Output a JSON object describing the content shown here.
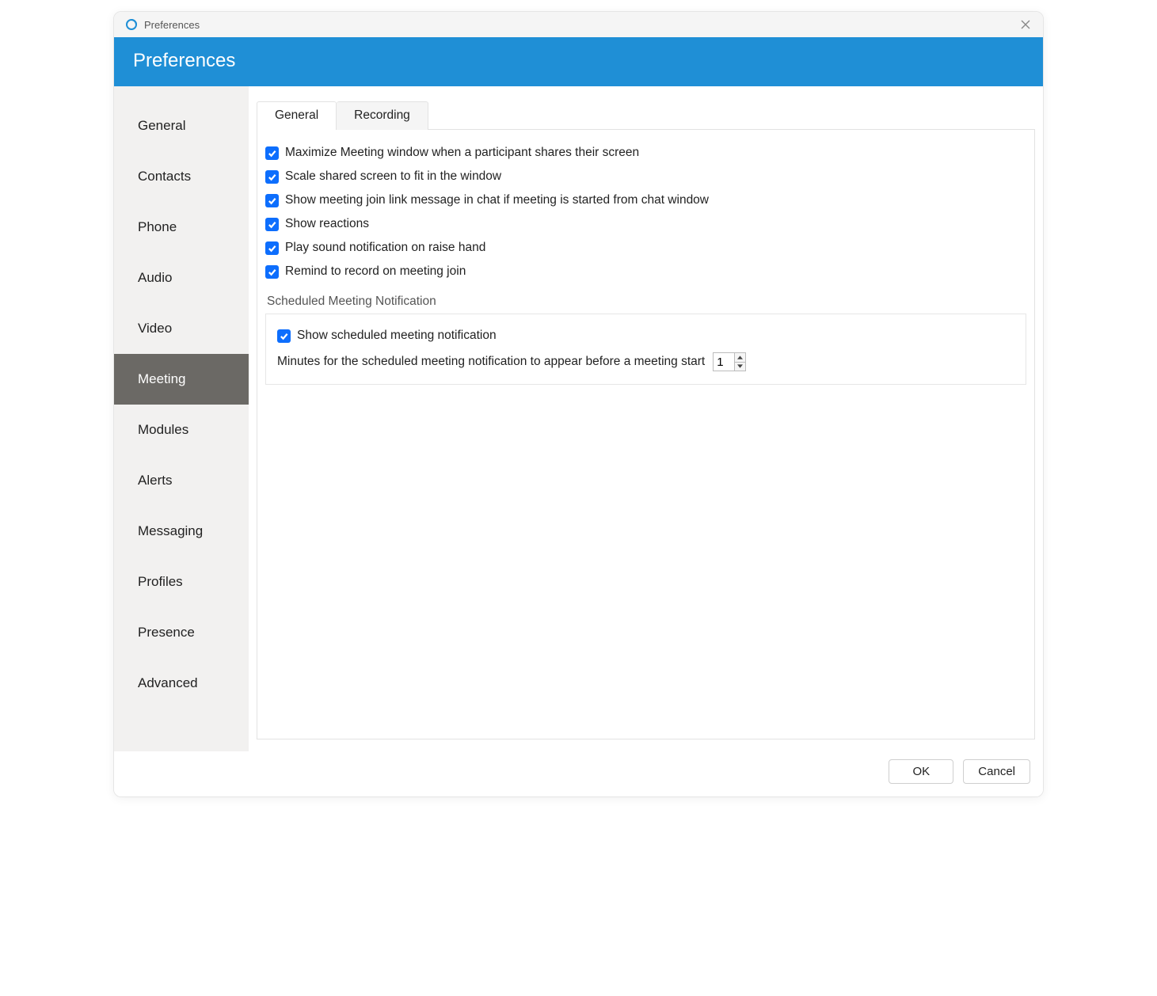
{
  "window": {
    "title": "Preferences"
  },
  "header": {
    "title": "Preferences"
  },
  "sidebar": {
    "items": [
      {
        "label": "General",
        "id": "general",
        "selected": false
      },
      {
        "label": "Contacts",
        "id": "contacts",
        "selected": false
      },
      {
        "label": "Phone",
        "id": "phone",
        "selected": false
      },
      {
        "label": "Audio",
        "id": "audio",
        "selected": false
      },
      {
        "label": "Video",
        "id": "video",
        "selected": false
      },
      {
        "label": "Meeting",
        "id": "meeting",
        "selected": true
      },
      {
        "label": "Modules",
        "id": "modules",
        "selected": false
      },
      {
        "label": "Alerts",
        "id": "alerts",
        "selected": false
      },
      {
        "label": "Messaging",
        "id": "messaging",
        "selected": false
      },
      {
        "label": "Profiles",
        "id": "profiles",
        "selected": false
      },
      {
        "label": "Presence",
        "id": "presence",
        "selected": false
      },
      {
        "label": "Advanced",
        "id": "advanced",
        "selected": false
      }
    ]
  },
  "tabs": [
    {
      "label": "General",
      "id": "tab-general",
      "active": true
    },
    {
      "label": "Recording",
      "id": "tab-recording",
      "active": false
    }
  ],
  "settings": {
    "checks": [
      {
        "label": "Maximize Meeting window when a participant shares their screen",
        "checked": true
      },
      {
        "label": "Scale shared screen to fit in the window",
        "checked": true
      },
      {
        "label": "Show meeting join link message in chat if meeting is started from chat window",
        "checked": true
      },
      {
        "label": "Show reactions",
        "checked": true
      },
      {
        "label": "Play sound notification on raise hand",
        "checked": true
      },
      {
        "label": "Remind to record on meeting join",
        "checked": true
      }
    ],
    "scheduled_group": {
      "title": "Scheduled Meeting Notification",
      "show_check": {
        "label": "Show scheduled meeting notification",
        "checked": true
      },
      "minutes_label": "Minutes for the scheduled meeting notification to appear before a meeting start",
      "minutes_value": "1"
    }
  },
  "footer": {
    "ok_label": "OK",
    "cancel_label": "Cancel"
  },
  "colors": {
    "accent": "#1f8fd6",
    "checkbox": "#0d6efd",
    "sidebar_selected_bg": "#6b6965"
  }
}
